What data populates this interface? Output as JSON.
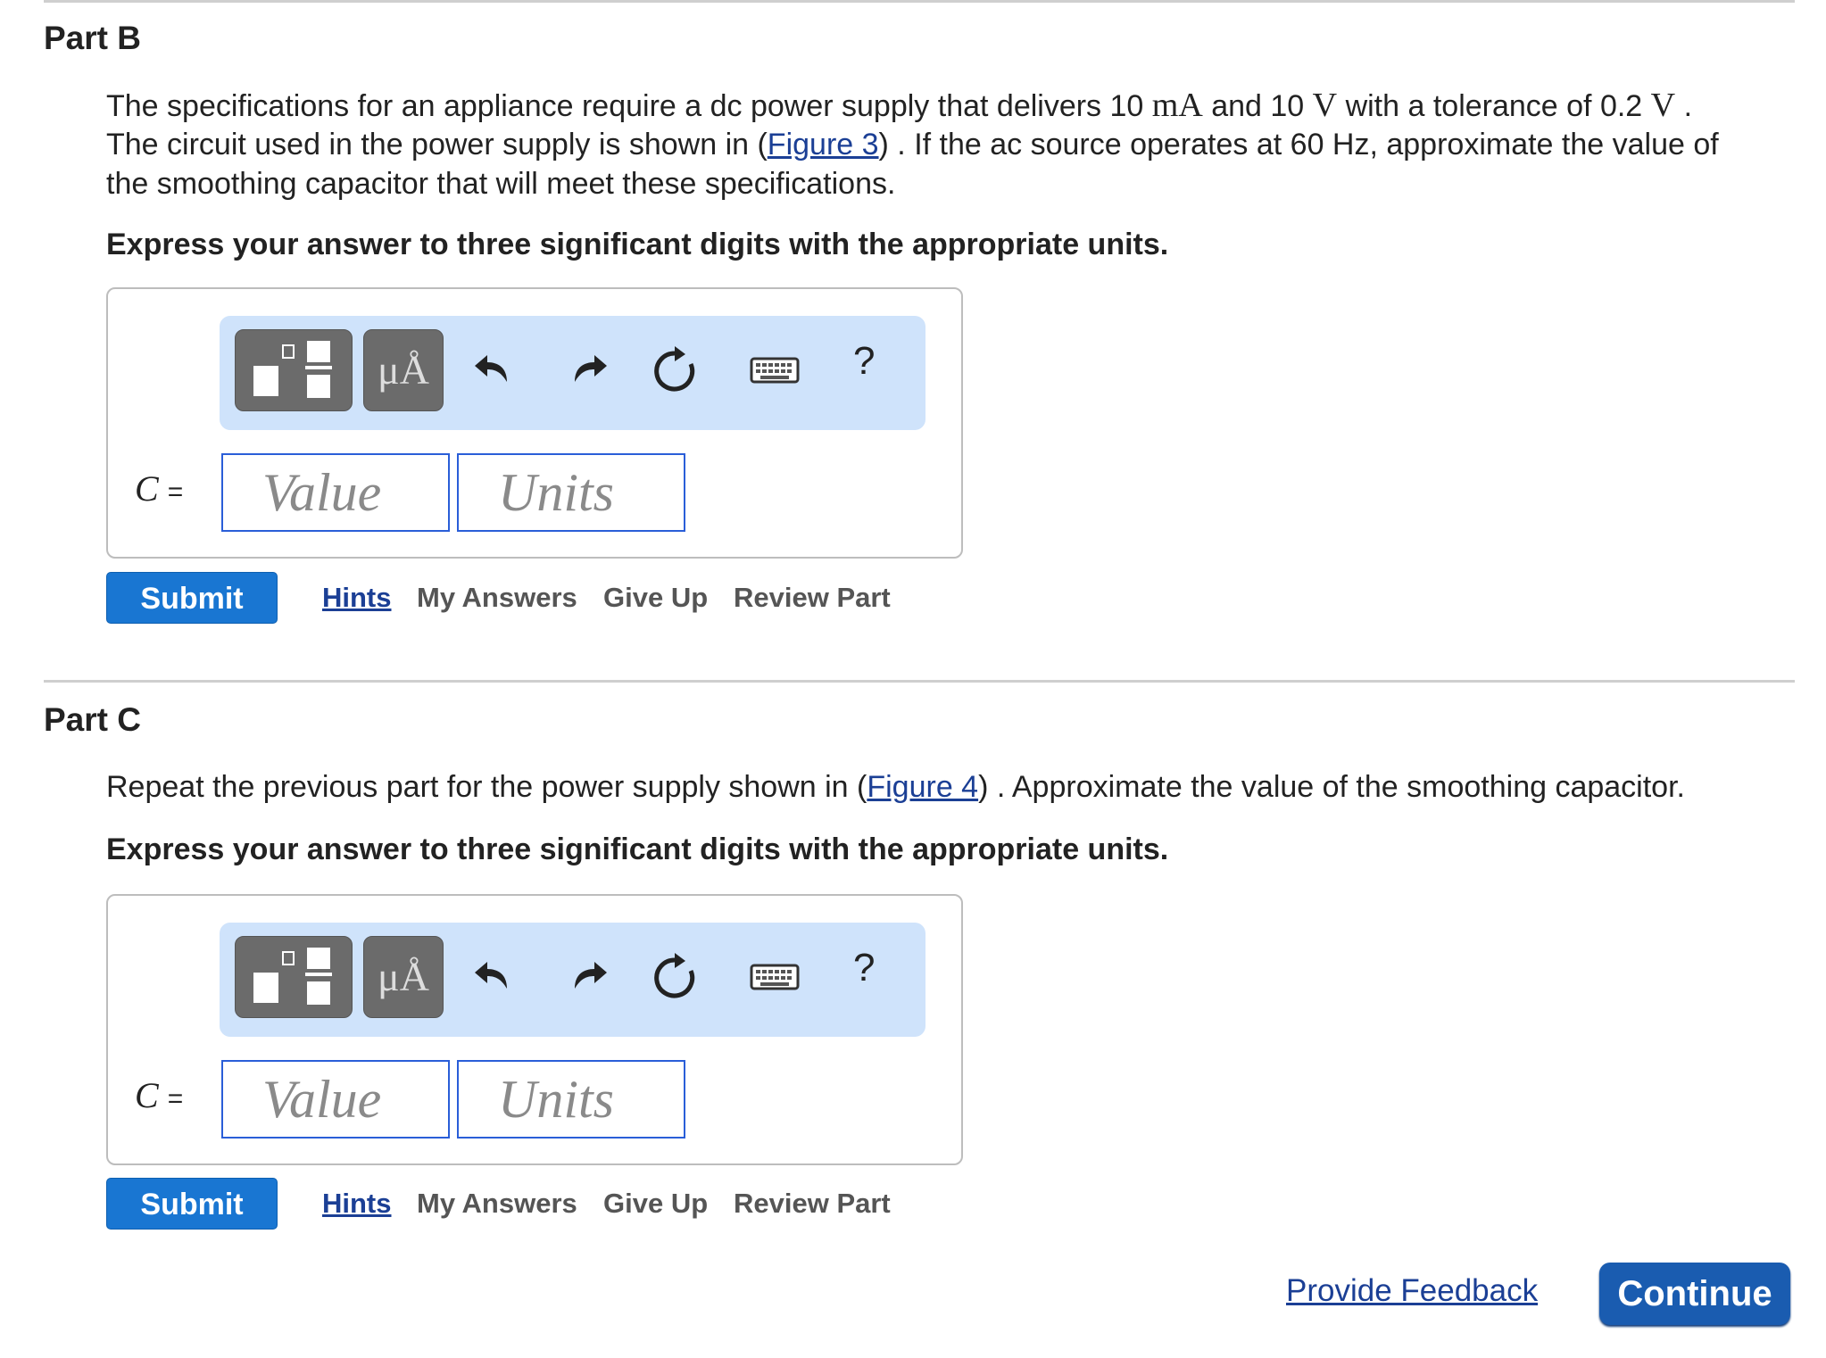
{
  "parts": [
    {
      "title": "Part B",
      "question": {
        "l1_a": "The specifications for an appliance require a dc power supply that delivers 10 ",
        "l1_unit1": "mA",
        "l1_b": " and 10 ",
        "l1_unit2": "V",
        "l1_c": " with a tolerance of 0.2 ",
        "l1_unit3": "V",
        "l1_d": " .",
        "l2_a": "The circuit used in the power supply is shown in (",
        "l2_link": "Figure 3",
        "l2_b": ") . If the ac source operates at 60 Hz, approximate the value of",
        "l3": "the smoothing capacitor that will meet these specifications."
      },
      "instruction": "Express your answer to three significant digits with the appropriate units.",
      "variable": "C",
      "equals": "=",
      "value_placeholder": "Value",
      "units_placeholder": "Units",
      "units_btn_label": "μÅ",
      "help_label": "?",
      "submit_label": "Submit",
      "hints_label": "Hints",
      "my_answers_label": "My Answers",
      "give_up_label": "Give Up",
      "review_part_label": "Review Part"
    },
    {
      "title": "Part C",
      "question": {
        "l1_a": "Repeat the previous part for the power supply shown in (",
        "l1_link": "Figure 4",
        "l1_b": ") . Approximate the value of the smoothing capacitor."
      },
      "instruction": "Express your answer to three significant digits with the appropriate units.",
      "variable": "C",
      "equals": "=",
      "value_placeholder": "Value",
      "units_placeholder": "Units",
      "units_btn_label": "μÅ",
      "help_label": "?",
      "submit_label": "Submit",
      "hints_label": "Hints",
      "my_answers_label": "My Answers",
      "give_up_label": "Give Up",
      "review_part_label": "Review Part"
    }
  ],
  "footer": {
    "feedback_label": "Provide Feedback",
    "continue_label": "Continue"
  },
  "icons": [
    "templates-icon",
    "units-icon",
    "undo-icon",
    "redo-icon",
    "reset-icon",
    "keyboard-icon",
    "help-icon"
  ],
  "colors": {
    "link": "#1b3f95",
    "submit": "#1976d2",
    "continue": "#1a5cb0",
    "toolbar": "#cfe3fb",
    "input_border": "#2a5ed8"
  }
}
